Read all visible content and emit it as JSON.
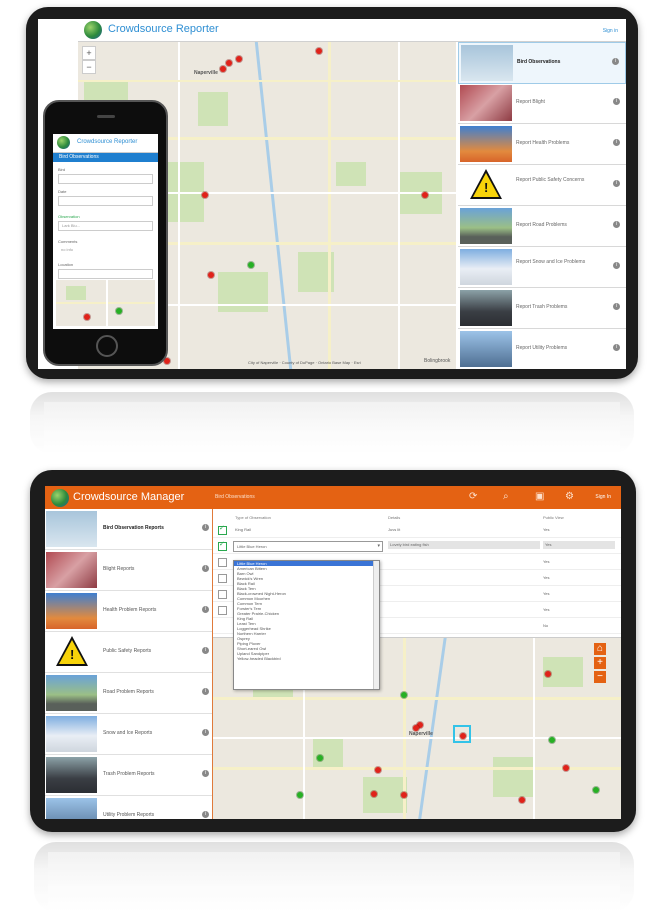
{
  "reporter": {
    "title": "Crowdsource Reporter",
    "signin": "Sign in",
    "zoom_in": "+",
    "zoom_out": "−",
    "attribution": "City of Naperville · County of DuPage · Ontario Base Map · Esri",
    "map_labels": [
      "Naperville",
      "Bolingbrook"
    ],
    "items": [
      {
        "label": "Bird Observations",
        "thumb": "bird"
      },
      {
        "label": "Report Blight",
        "thumb": "blight"
      },
      {
        "label": "Report Health Problems",
        "thumb": "health"
      },
      {
        "label": "Report Public Safety Concerns",
        "thumb": "safety"
      },
      {
        "label": "Report Road Problems",
        "thumb": "road"
      },
      {
        "label": "Report Snow and Ice Problems",
        "thumb": "snow"
      },
      {
        "label": "Report Trash Problems",
        "thumb": "trash"
      },
      {
        "label": "Report Utility Problems",
        "thumb": "utility"
      }
    ]
  },
  "phone": {
    "title": "Crowdsource Reporter",
    "subheader": "Bird Observations",
    "field_labels": [
      "Bird",
      "Date",
      "Observation",
      "Comments",
      "Location"
    ],
    "field_values": [
      "",
      "",
      "Lark Blu...",
      "no info",
      ""
    ],
    "comments_value": "no info"
  },
  "manager": {
    "title": "Crowdsource Manager",
    "subtitle": "Bird Observations",
    "signin": "Sign In",
    "icons": [
      "refresh-icon",
      "search-icon",
      "table-icon",
      "gear-icon"
    ],
    "table": {
      "columns": [
        "Type of Observation",
        "Details",
        "Public View"
      ],
      "rows": [
        {
          "checked": true,
          "type": "King Rail",
          "details": "Juvs lit",
          "public": "Yes"
        },
        {
          "checked": true,
          "type": "Little Blue Heron",
          "details": "Lovely bird eating fish",
          "public": "Yes"
        },
        {
          "checked": false,
          "type": "",
          "details": "",
          "public": "Yes"
        },
        {
          "checked": false,
          "type": "",
          "details": "",
          "public": "Yes"
        },
        {
          "checked": false,
          "type": "",
          "details": "",
          "public": "Yes"
        },
        {
          "checked": false,
          "type": "",
          "details": "",
          "public": "Yes"
        },
        {
          "checked": false,
          "type": "",
          "details": "",
          "public": "No"
        }
      ],
      "dropdown_value": "Little Blue Heron",
      "dropdown_options": [
        "Little Blue Heron",
        "American Bittern",
        "Barn Owl",
        "Bewick's Wren",
        "Black Rail",
        "Black Tern",
        "Black-crowned Night-Heron",
        "Common Moorhen",
        "Common Tern",
        "Forster's Tern",
        "Greater Prairie-Chicken",
        "King Rail",
        "Least Tern",
        "Loggerhead Shrike",
        "Northern Harrier",
        "Osprey",
        "Piping Plover",
        "Short-eared Owl",
        "Upland Sandpiper",
        "Yellow-headed Blackbird"
      ]
    },
    "zoom_in": "+",
    "zoom_out": "−",
    "home": "⌂",
    "map_labels": [
      "Naperville"
    ],
    "items": [
      {
        "label": "Bird Observation Reports",
        "thumb": "bird"
      },
      {
        "label": "Blight Reports",
        "thumb": "blight"
      },
      {
        "label": "Health Problem Reports",
        "thumb": "health"
      },
      {
        "label": "Public Safety Reports",
        "thumb": "safety"
      },
      {
        "label": "Road Problem Reports",
        "thumb": "road"
      },
      {
        "label": "Snow and Ice Reports",
        "thumb": "snow"
      },
      {
        "label": "Trash Problem Reports",
        "thumb": "trash"
      },
      {
        "label": "Utility Problem Reports",
        "thumb": "utility"
      }
    ]
  },
  "colors": {
    "reporter_accent": "#2f8fd3",
    "manager_accent": "#e46213",
    "pin_red": "#e0221a",
    "pin_green": "#27b024",
    "selection": "#33c3e8"
  }
}
